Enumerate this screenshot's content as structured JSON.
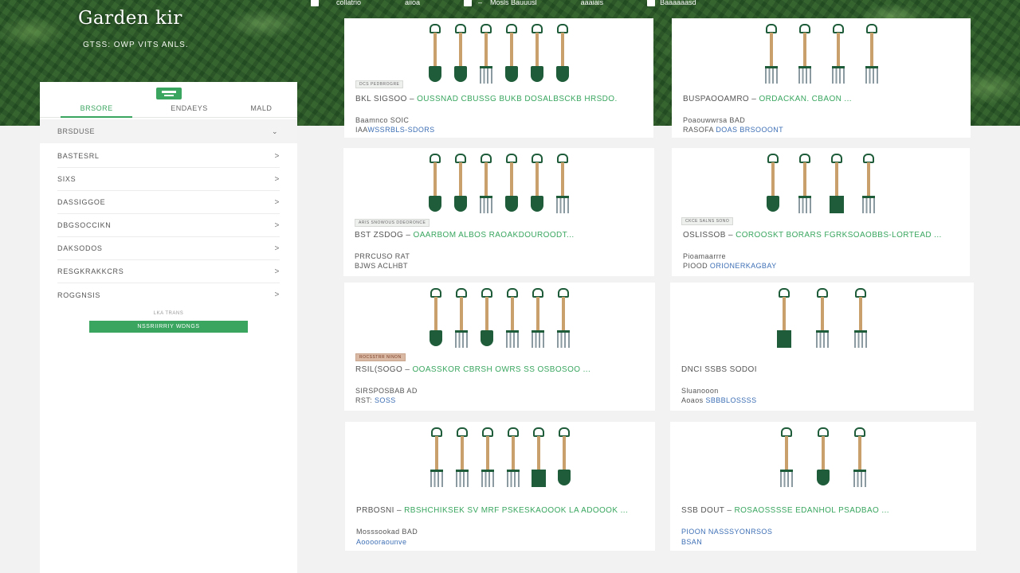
{
  "hero": {
    "title": "Garden kir",
    "subtitle": "GTSS: OWP VITS ANLS."
  },
  "topnav": [
    {
      "icon": "lock-icon",
      "label": "collatrio"
    },
    {
      "icon": null,
      "label": "aiioa"
    },
    {
      "icon": "bag-icon",
      "label": "–"
    },
    {
      "icon": null,
      "label": "Mosls Bauuusl"
    },
    {
      "icon": null,
      "label": "aaaiais"
    },
    {
      "icon": "cart-icon",
      "label": "Baaaaaasd"
    }
  ],
  "sidebar": {
    "tabs": [
      "BRSORE",
      "ENDAEYS",
      "MALD"
    ],
    "filter": {
      "label": "BRSDUSE",
      "chevron": "⌄"
    },
    "items": [
      {
        "label": "BASTESRL",
        "chevron": ">"
      },
      {
        "label": "SIXS",
        "chevron": ">"
      },
      {
        "label": "DASSIGGOE",
        "chevron": ">"
      },
      {
        "label": "DBGSOCCIKN",
        "chevron": ">"
      },
      {
        "label": "DAKSODOS",
        "chevron": ">"
      },
      {
        "label": "RESGKRAKKCRS",
        "chevron": ">"
      },
      {
        "label": "ROGGNSIS",
        "chevron": ">"
      }
    ],
    "note": "LKA TRANS",
    "button": "NSSRIIRRIY WDNGS"
  },
  "products": [
    {
      "badge": "DCS PEDBROGRE",
      "badge_style": "plain",
      "title_lead": "BKL SIGSOO –",
      "title": "OUSSNAD CBUSSG BUKB DOSALBSCKB HRSDO.",
      "meta": "Baamnco SOIC",
      "price_lead": "IAA",
      "price": "WSSRBLS-SDORS",
      "tools": [
        "spade",
        "spade",
        "fork",
        "spade",
        "spade",
        "spade"
      ]
    },
    {
      "badge": "",
      "badge_style": "none",
      "title_lead": "BUSPAOOAMRO –",
      "title": "ORDACKAN. CBAON ...",
      "meta": "Poaouwwrsa BAD",
      "price_lead": "RASOFA",
      "price": "DOAS BRSOOONT",
      "tools": [
        "fork",
        "fork",
        "fork",
        "fork"
      ]
    },
    {
      "badge": "ARIS SNOWOUS DDEORONCE",
      "badge_style": "plain",
      "title_lead": "BST ZSDOG –",
      "title": "OAARBOM ALBOS RAOAKDOUROODT...",
      "meta": "PRRCUSO RAT",
      "price_lead": "BJWS",
      "price": "ACLHBT",
      "tools": [
        "spade",
        "spade",
        "fork",
        "spade",
        "spade",
        "fork"
      ]
    },
    {
      "badge": "CKCE SALNS SONO",
      "badge_style": "plain",
      "title_lead": "OSLISSOB –",
      "title": "COROOSKT BORARS FGRKSOAOBBS-LORTEAD ...",
      "meta": "Pioamaarrre",
      "price_lead": "PIOOD",
      "price": "ORIONERKAGBAY",
      "tools": [
        "spade",
        "fork",
        "flat",
        "fork"
      ]
    },
    {
      "badge": "ROCSSTRR NINON",
      "badge_style": "red",
      "title_lead": "RSIL(SOGO –",
      "title": "OOASSKOR CBRSH OWRS SS OSBOSOO ...",
      "meta": "SIRSPOSBAB AD",
      "price_lead": "RST:",
      "price": "SOSS",
      "tools": [
        "spade",
        "fork",
        "spade",
        "fork",
        "fork",
        "fork"
      ]
    },
    {
      "badge": "",
      "badge_style": "none",
      "title_lead": "DNCI SSBS SODOI",
      "title": "",
      "meta": "Sluanooon",
      "price_lead": "Aoaos",
      "price": "SBBBLOSSSS",
      "tools": [
        "flat",
        "fork",
        "fork"
      ]
    },
    {
      "badge": "",
      "badge_style": "none",
      "title_lead": "PRBOSNI –",
      "title": "RBSHCHIKSEK SV MRF PSKESKAOOOK LA ADOOOK ...",
      "meta": "Mosssookad BAD",
      "price_lead": "",
      "price": "Aooooraounve",
      "tools": [
        "fork",
        "fork",
        "fork",
        "fork",
        "flat",
        "spade"
      ]
    },
    {
      "badge": "",
      "badge_style": "none",
      "title_lead": "SSB DOUT –",
      "title": "ROSAOSSSSE EDANHOL PSADBAO ...",
      "meta": "",
      "price_lead": "",
      "price": "PIOON NASSSYONRSOS",
      "price2": "BSAN",
      "tools": [
        "fork",
        "spade",
        "fork"
      ]
    }
  ]
}
